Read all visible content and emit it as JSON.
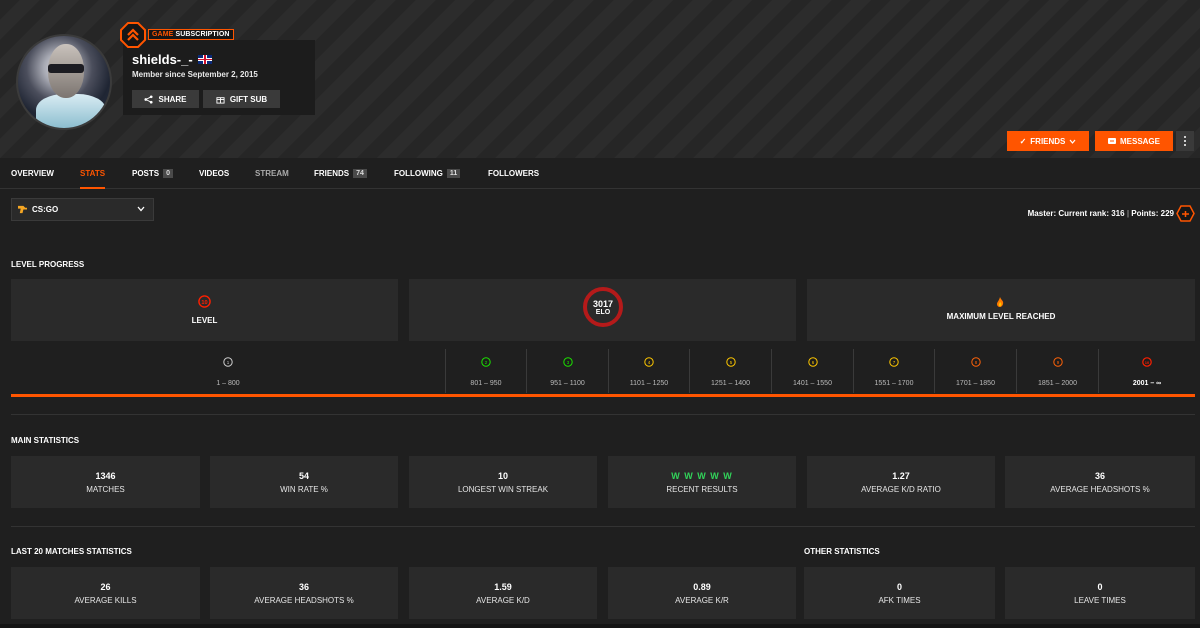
{
  "colors": {
    "accent": "#ff5500",
    "background": "#1f1f1f",
    "card": "#2a2a2a",
    "win": "#32d35a",
    "elo_ring": "#b51a1a"
  },
  "profile": {
    "subscription_prefix": "GAME",
    "subscription_suffix": "SUBSCRIPTION",
    "username": "shields-_-",
    "member_since": "Member since September 2, 2015",
    "share_label": "SHARE",
    "gift_label": "GIFT SUB"
  },
  "actions": {
    "friends_label": "FRIENDS",
    "message_label": "MESSAGE"
  },
  "tabs": [
    {
      "label": "OVERVIEW",
      "count": null
    },
    {
      "label": "STATS",
      "count": null
    },
    {
      "label": "POSTS",
      "count": "0"
    },
    {
      "label": "VIDEOS",
      "count": null
    },
    {
      "label": "STREAM",
      "count": null
    },
    {
      "label": "FRIENDS",
      "count": "74"
    },
    {
      "label": "FOLLOWING",
      "count": "11"
    },
    {
      "label": "FOLLOWERS",
      "count": null
    }
  ],
  "game_select": {
    "value": "CS:GO"
  },
  "rank": {
    "prefix": "Master",
    "current_rank_label": ": Current rank: ",
    "current_rank": "316",
    "points_label": " Points: ",
    "points": "229"
  },
  "level_progress": {
    "title": "LEVEL PROGRESS",
    "level_value": "10",
    "level_label": "LEVEL",
    "elo_value": "3017",
    "elo_label": "ELO",
    "max_label": "MAXIMUM LEVEL REACHED",
    "levels": [
      {
        "level": "1",
        "range": "1 – 800",
        "color": "#cfcfcf"
      },
      {
        "level": "2",
        "range": "801 – 950",
        "color": "#1ce400"
      },
      {
        "level": "3",
        "range": "951 – 1100",
        "color": "#1ce400"
      },
      {
        "level": "4",
        "range": "1101 – 1250",
        "color": "#ffc800"
      },
      {
        "level": "5",
        "range": "1251 – 1400",
        "color": "#ffc800"
      },
      {
        "level": "6",
        "range": "1401 – 1550",
        "color": "#ffc800"
      },
      {
        "level": "7",
        "range": "1551 – 1700",
        "color": "#ffc800"
      },
      {
        "level": "8",
        "range": "1701 – 1850",
        "color": "#ff6309"
      },
      {
        "level": "9",
        "range": "1851 – 2000",
        "color": "#ff6309"
      },
      {
        "level": "10",
        "range": "2001 – ∞",
        "color": "#fe1f00"
      }
    ]
  },
  "main_statistics": {
    "title": "MAIN STATISTICS",
    "items": [
      {
        "value": "1346",
        "label": "MATCHES"
      },
      {
        "value": "54",
        "label": "WIN RATE %"
      },
      {
        "value": "10",
        "label": "LONGEST WIN STREAK"
      },
      {
        "value": "W W W W W",
        "label": "RECENT RESULTS"
      },
      {
        "value": "1.27",
        "label": "AVERAGE K/D RATIO"
      },
      {
        "value": "36",
        "label": "AVERAGE HEADSHOTS %"
      }
    ]
  },
  "last20": {
    "title": "LAST 20 MATCHES STATISTICS",
    "items": [
      {
        "value": "26",
        "label": "AVERAGE KILLS"
      },
      {
        "value": "36",
        "label": "AVERAGE HEADSHOTS %"
      },
      {
        "value": "1.59",
        "label": "AVERAGE K/D"
      },
      {
        "value": "0.89",
        "label": "AVERAGE K/R"
      }
    ]
  },
  "other": {
    "title": "OTHER STATISTICS",
    "items": [
      {
        "value": "0",
        "label": "AFK TIMES"
      },
      {
        "value": "0",
        "label": "LEAVE TIMES"
      }
    ]
  }
}
